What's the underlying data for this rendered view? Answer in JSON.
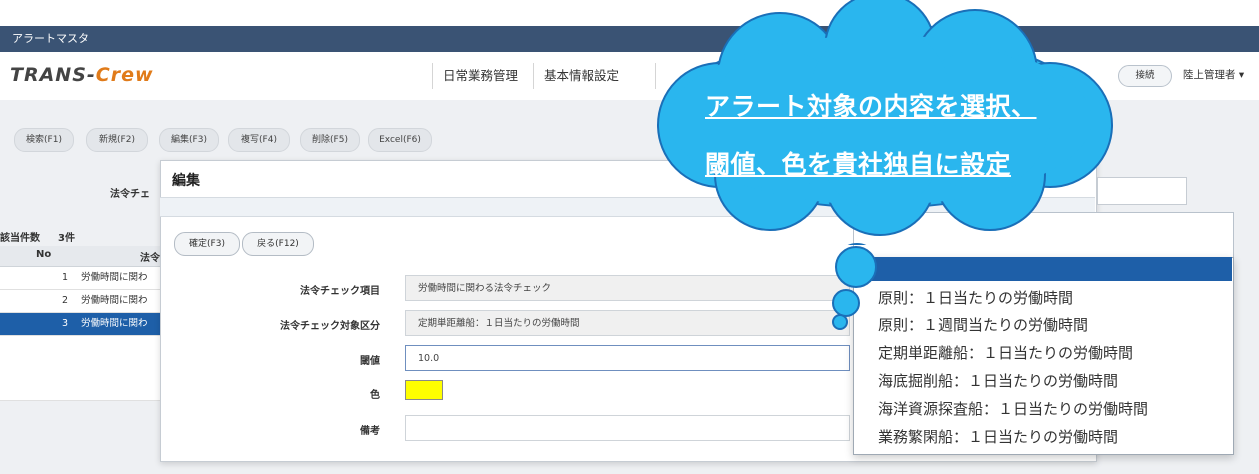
{
  "window_title": "アラートマスタ",
  "logo": {
    "trans": "TRANS-",
    "crew": "Crew"
  },
  "nav": [
    "日常業務管理",
    "基本情報設定"
  ],
  "header_right": {
    "connect_label": "接続",
    "user_label": "陸上管理者 ▾"
  },
  "toolbar": [
    "検索(F1)",
    "新規(F2)",
    "編集(F3)",
    "複写(F4)",
    "削除(F5)",
    "Excel(F6)"
  ],
  "background_page": {
    "filter_label": "法令チェ",
    "count_label": "該当件数",
    "count_value": "3件",
    "col_no": "No",
    "col_item": "法令",
    "rows": [
      {
        "no": "1",
        "text": "労働時間に関わ"
      },
      {
        "no": "2",
        "text": "労働時間に関わ"
      },
      {
        "no": "3",
        "text": "労働時間に関わ"
      }
    ]
  },
  "modal": {
    "title": "編集",
    "buttons": [
      "確定(F3)",
      "戻る(F12)"
    ],
    "fields": {
      "check_item_label": "法令チェック項目",
      "check_item_value": "労働時間に関わる法令チェック",
      "target_label": "法令チェック対象区分",
      "target_value": "定期単距離船：１日当たりの労働時間",
      "threshold_label": "閾値",
      "threshold_value": "10.0",
      "color_label": "色",
      "color_value": "#ffff00",
      "memo_label": "備考",
      "memo_value": ""
    }
  },
  "dropdown_options": [
    "原則：１日当たりの労働時間",
    "原則：１週間当たりの労働時間",
    "定期単距離船：１日当たりの労働時間",
    "海底掘削船：１日当たりの労働時間",
    "海洋資源探査船：１日当たりの労働時間",
    "業務繁閑船：１日当たりの労働時間"
  ],
  "callout": {
    "line1": "アラート対象の内容を選択、",
    "line2": "閾値、色を貴社独自に設定"
  },
  "colors": {
    "titlebar": "#3a5374",
    "selected": "#1e5fa8",
    "cloud": "#2ab6ee",
    "crew": "#e07b1a"
  }
}
